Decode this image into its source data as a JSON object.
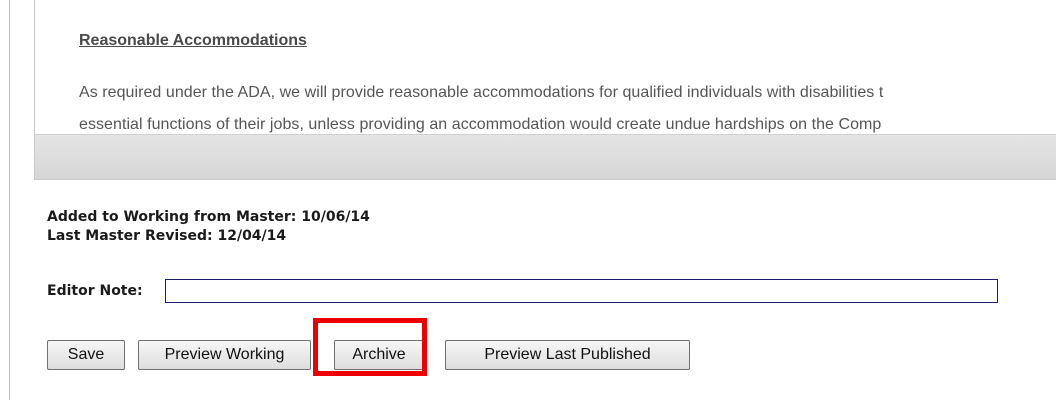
{
  "document": {
    "heading": "Reasonable Accommodations",
    "line1": "As required under the ADA, we will provide reasonable accommodations for qualified individuals with disabilities t",
    "line2": "essential functions of their jobs, unless providing an accommodation would create undue hardships on the Comp"
  },
  "meta": {
    "added_to_working": "Added to Working from Master: 10/06/14",
    "last_master_revised": "Last Master Revised: 12/04/14"
  },
  "editor_note": {
    "label": "Editor Note:",
    "value": ""
  },
  "buttons": {
    "save": "Save",
    "preview_working": "Preview Working",
    "archive": "Archive",
    "preview_last_published": "Preview Last Published"
  },
  "colors": {
    "highlight": "#ee0000",
    "input_border": "#1c1c6e"
  }
}
